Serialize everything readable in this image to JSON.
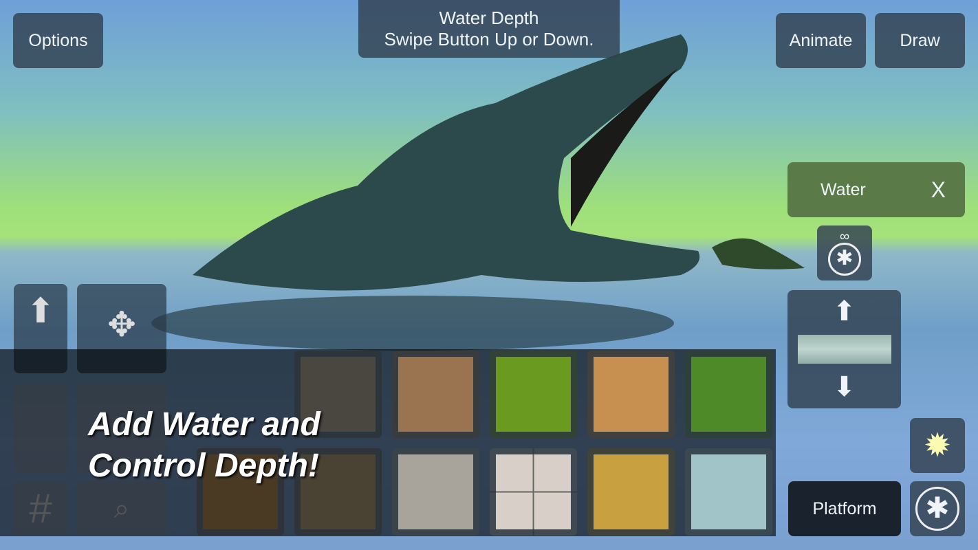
{
  "top": {
    "options": "Options",
    "hint_line1": "Water Depth",
    "hint_line2": "Swipe Button Up or Down.",
    "animate": "Animate",
    "draw": "Draw"
  },
  "side": {
    "water_label": "Water",
    "close": "X",
    "platform": "Platform"
  },
  "promo": {
    "line1": "Add Water and",
    "line2": "Control Depth!"
  },
  "tiles": [
    "dirt-grass",
    "cracked-earth",
    "leafy-grass",
    "sand",
    "tall-grass",
    "brown-mud",
    "dark-rock",
    "stone-tiles",
    "white-tiles",
    "yellow-sand",
    "water"
  ],
  "colors": {
    "panel": "#324150",
    "water_panel": "#5a7a48",
    "sun": "#fafab0"
  }
}
